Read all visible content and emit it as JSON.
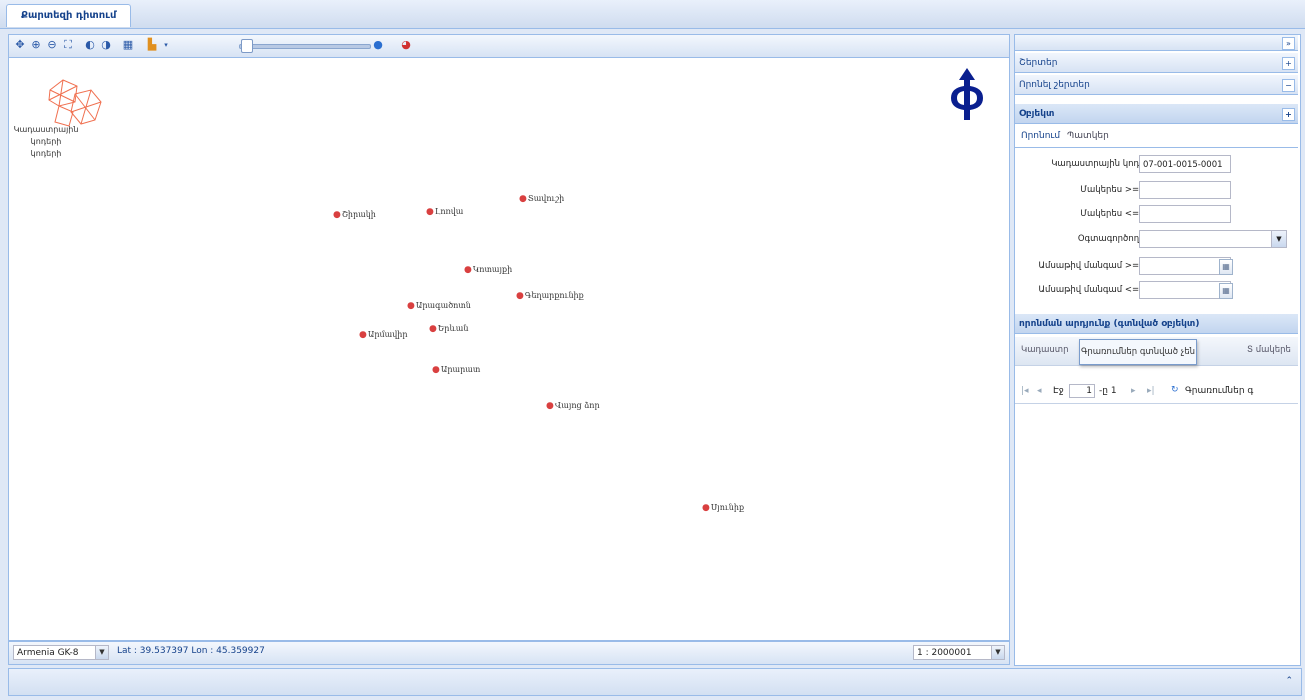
{
  "tab": {
    "title": "Քարտեզի դիտում"
  },
  "toolbar": {
    "icons": [
      "pan-icon",
      "zoom-in-icon",
      "zoom-out-icon",
      "zoom-extent-icon",
      "previous-extent-icon",
      "next-extent-icon",
      "select-icon",
      "layers-icon",
      "info-icon",
      "print-icon"
    ],
    "zoom_level": 0.05
  },
  "map": {
    "legend_label": "Կադաստրային կոդերի",
    "legend_label2": "կոդերի",
    "cities": [
      {
        "name": "Շիրակի"
      },
      {
        "name": "Լոռվա"
      },
      {
        "name": "Տավուշի"
      },
      {
        "name": "Կոտայքի"
      },
      {
        "name": "Արմավիր"
      },
      {
        "name": "Արագածոտն"
      },
      {
        "name": "Երևան"
      },
      {
        "name": "Գեղարքունիք"
      },
      {
        "name": "Արարատ"
      },
      {
        "name": "Վայոց ձոր"
      },
      {
        "name": "Սյունիք"
      }
    ]
  },
  "statusbar": {
    "projection": "Armenia GK-8",
    "coords": "Lat : 39.537397  Lon : 45.359927",
    "scale": "1 : 2000001"
  },
  "panel": {
    "sections": [
      {
        "label": "Շերտեր",
        "tool": "+"
      },
      {
        "label": "Որոնել շերտեր",
        "tool": "−"
      },
      {
        "label": "Օբյեկտ",
        "tool": "+"
      }
    ],
    "subtabs": [
      "Որոնում",
      "Պատկեր"
    ],
    "form": [
      {
        "label": "Կադաստրային կոդ:",
        "value": "07-001-0015-0001"
      },
      {
        "label": "Մակերես >=:",
        "value": ""
      },
      {
        "label": "Մակերես <=:",
        "value": ""
      },
      {
        "label": "Օգտագործող:",
        "value": ""
      },
      {
        "label": "Ամսաթիվ մանգամ >=:",
        "value": ""
      },
      {
        "label": "Ամսաթիվ մանգամ <=:",
        "value": ""
      }
    ],
    "results_header": "որոնման արդյունք (գտնված օբյեկտ)",
    "grid_columns": [
      "Կադաստր",
      "Տ մակերե"
    ],
    "tooltip": "Գրառումներ գտնված չեն",
    "pager": {
      "page_label": "Էջ",
      "page_value": "1",
      "of_label": "-ը 1",
      "refresh_label": "Գրառումներ գ"
    }
  }
}
